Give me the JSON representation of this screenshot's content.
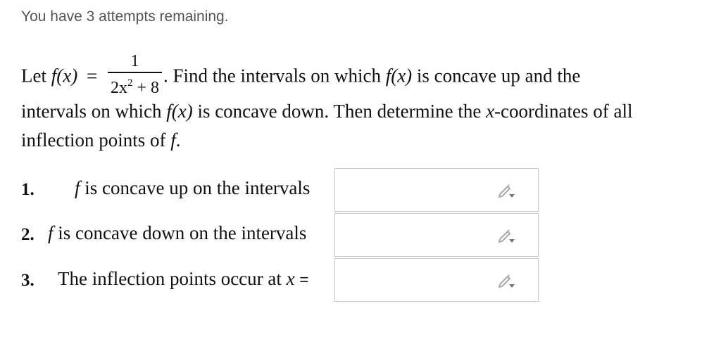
{
  "attempts_text": "You have 3 attempts remaining.",
  "problem": {
    "let_text": "Let",
    "f_of_x": "f(x)",
    "equals": "=",
    "numerator": "1",
    "denominator_lead": "2x",
    "denominator_exp": "2",
    "denominator_tail": " + 8",
    "after_fraction": ". Find the intervals on which",
    "clause_end_line1": "is concave up and the",
    "line2_start": "intervals on which",
    "line2_mid": "is concave down. Then determine the",
    "x_var": "x",
    "line2_end": "-coordinates of all",
    "line3_start": "inflection points of",
    "f_var": "f",
    "period": "."
  },
  "questions": [
    {
      "number": "1.",
      "f_var": "f",
      "text": "is concave up on the intervals"
    },
    {
      "number": "2.",
      "f_var": "f",
      "text": "is concave down on the intervals"
    },
    {
      "number": "3.",
      "text": "The inflection points occur at",
      "x_var": "x",
      "equals": "="
    }
  ],
  "answers": [
    {
      "value": "",
      "icon": "pencil-dropdown-icon"
    },
    {
      "value": "",
      "icon": "pencil-dropdown-icon"
    },
    {
      "value": "",
      "icon": "pencil-dropdown-icon"
    }
  ],
  "colors": {
    "text": "#111111",
    "muted": "#555555",
    "border": "#c9c9c9",
    "icon": "#aaaaaa"
  }
}
